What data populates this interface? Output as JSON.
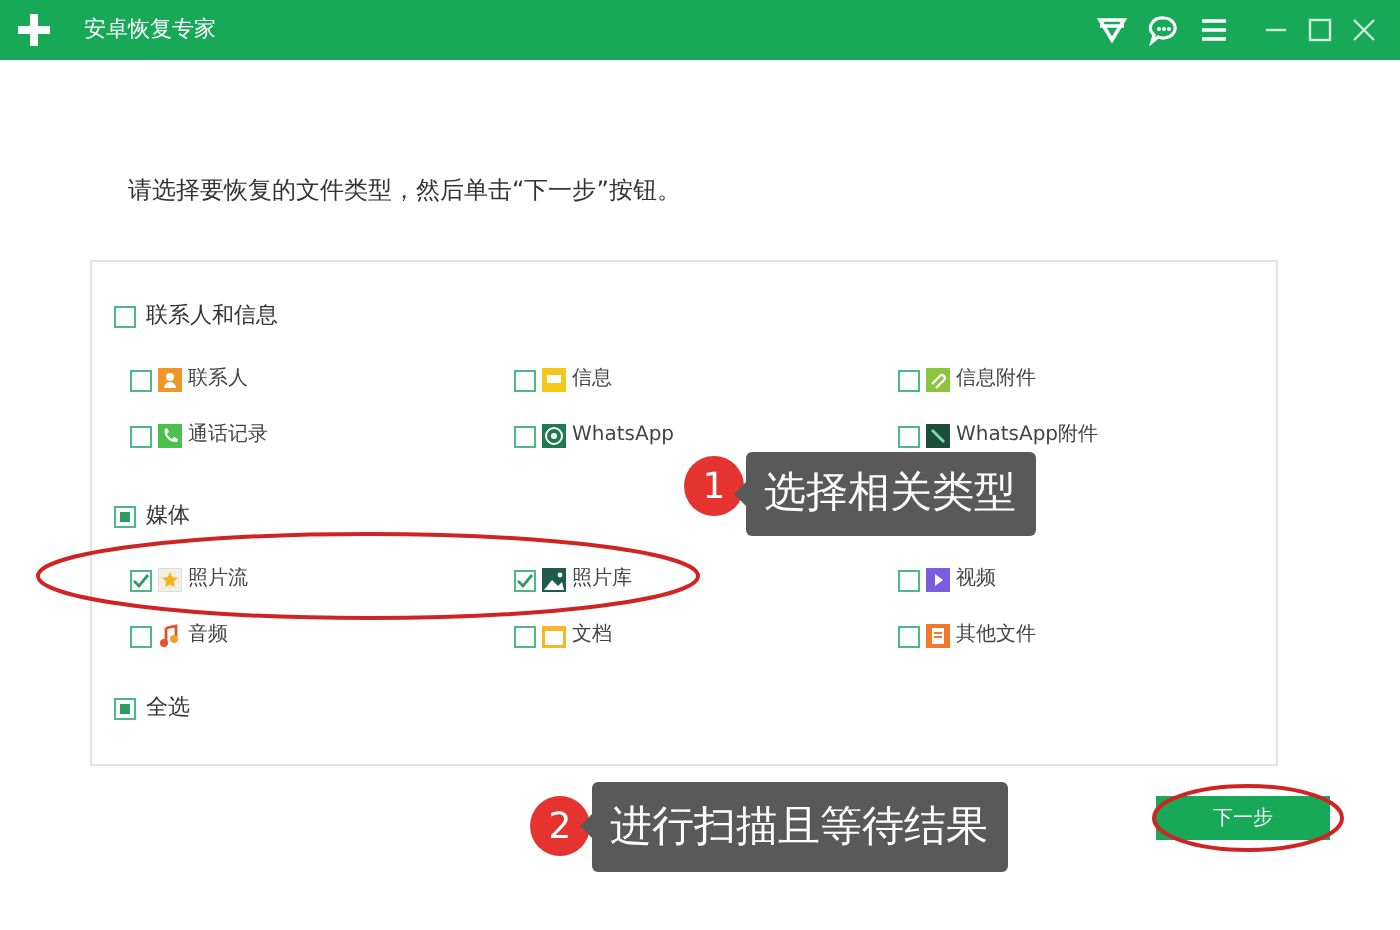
{
  "window": {
    "title": "安卓恢复专家"
  },
  "instruction": "请选择要恢复的文件类型，然后单击“下一步”按钮。",
  "groups": [
    {
      "label": "联系人和信息",
      "partial": false,
      "items": [
        {
          "label": "联系人",
          "kind": "contacts",
          "checked": false
        },
        {
          "label": "信息",
          "kind": "messages",
          "checked": false
        },
        {
          "label": "信息附件",
          "kind": "attachments",
          "checked": false
        },
        {
          "label": "通话记录",
          "kind": "calls",
          "checked": false
        },
        {
          "label": "WhatsApp",
          "kind": "whatsapp",
          "checked": false
        },
        {
          "label": "WhatsApp附件",
          "kind": "whatsapp-files",
          "checked": false
        }
      ]
    },
    {
      "label": "媒体",
      "partial": true,
      "items": [
        {
          "label": "照片流",
          "kind": "photostream",
          "checked": true
        },
        {
          "label": "照片库",
          "kind": "gallery",
          "checked": true
        },
        {
          "label": "视频",
          "kind": "video",
          "checked": false
        },
        {
          "label": "音频",
          "kind": "audio",
          "checked": false
        },
        {
          "label": "文档",
          "kind": "documents",
          "checked": false
        },
        {
          "label": "其他文件",
          "kind": "other",
          "checked": false
        }
      ]
    }
  ],
  "select_all": {
    "label": "全选",
    "partial": true
  },
  "next_button": "下一步",
  "annotations": [
    {
      "number": "1",
      "text": "选择相关类型"
    },
    {
      "number": "2",
      "text": "进行扫描且等待结果"
    }
  ]
}
